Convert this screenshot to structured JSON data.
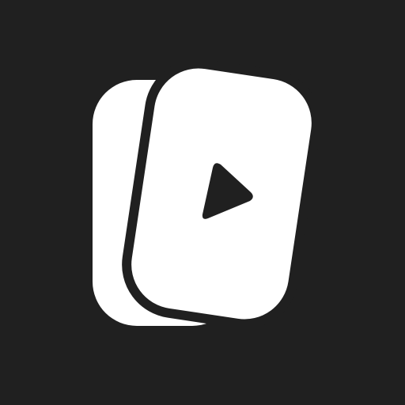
{
  "icon": {
    "name": "video-cards-play-icon",
    "colors": {
      "background": "#202020",
      "foreground": "#FFFFFF",
      "play": "#202020"
    }
  }
}
